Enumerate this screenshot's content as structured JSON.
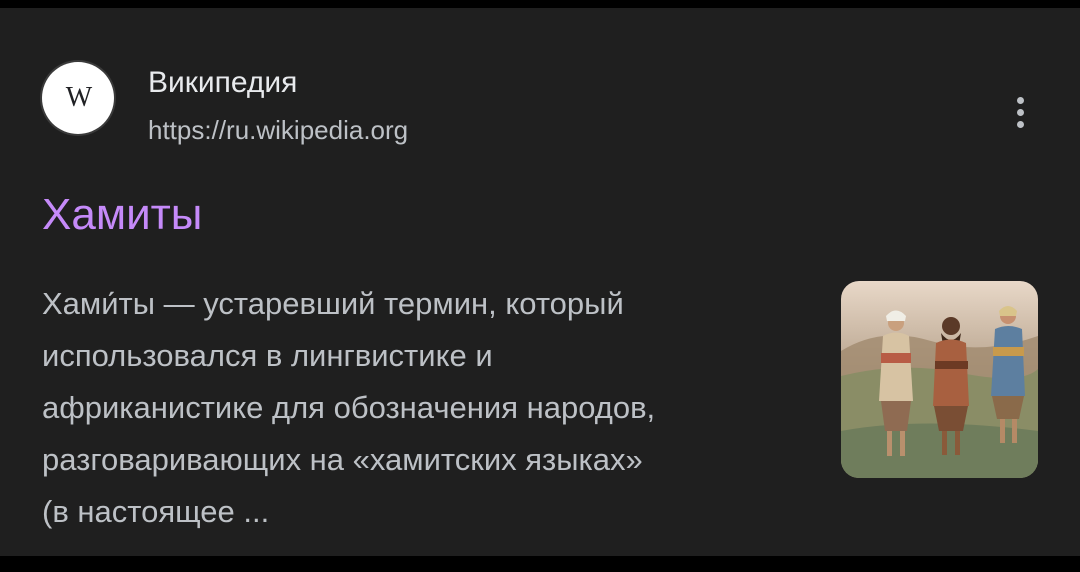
{
  "result": {
    "favicon": {
      "letter": "W",
      "icon": "wikipedia-logo-icon"
    },
    "site_name": "Википедия",
    "url": "https://ru.wikipedia.org",
    "more_icon": "more-vertical-icon",
    "title": "Хамиты",
    "snippet_lines": [
      "Хами́ты — устаревший термин, который",
      "использовался в лингвистике и",
      "африканистике для обозначения народов,",
      "разговаривающих на «хамитских языках»",
      "(в настоящее ..."
    ],
    "thumbnail_icon": "painting-thumbnail"
  },
  "colors": {
    "background": "#1f1f1f",
    "title": "#c58af9",
    "text": "#bdc1c6",
    "heading": "#e8eaed"
  }
}
